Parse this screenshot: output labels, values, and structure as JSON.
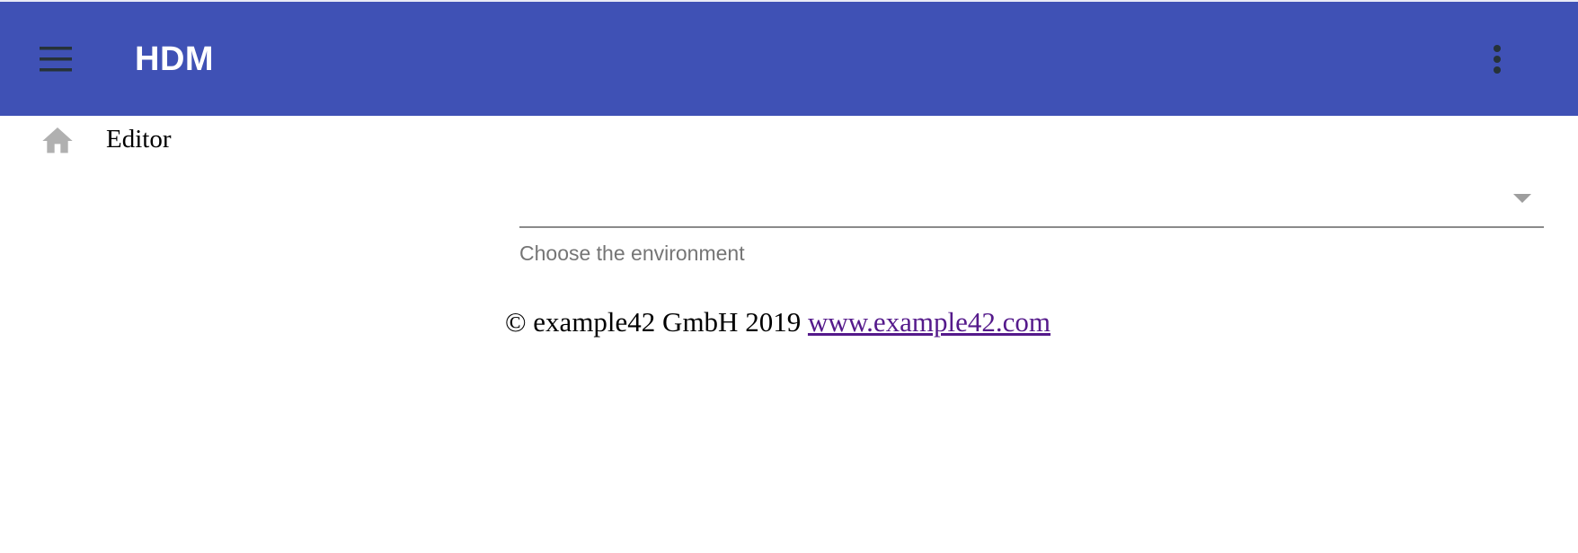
{
  "toolbar": {
    "title": "HDM",
    "background_color": "#3f51b5",
    "menu_icon": "menu-icon",
    "more_icon": "more-vert-icon"
  },
  "breadcrumb": {
    "home_icon": "home-icon",
    "label": "Editor"
  },
  "environment_select": {
    "selected_value": "",
    "hint": "Choose the environment"
  },
  "footer": {
    "copyright": "© example42 GmbH 2019",
    "link_text": "www.example42.com"
  }
}
